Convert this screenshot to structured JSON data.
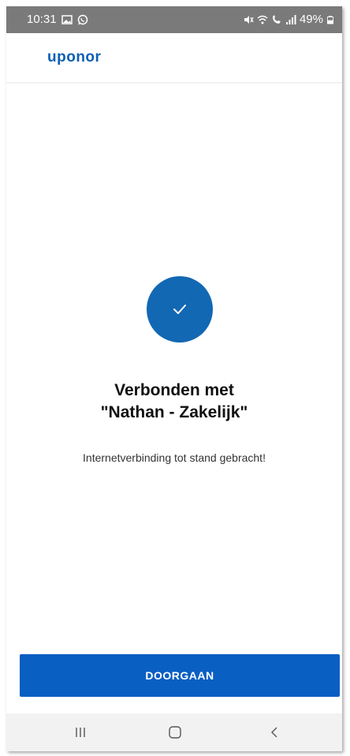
{
  "status_bar": {
    "time": "10:31",
    "battery": "49%",
    "left_icons": [
      "gallery-icon",
      "whatsapp-icon"
    ],
    "right_icons": [
      "mute-icon",
      "wifi-icon",
      "wifi-call-icon",
      "signal-icon",
      "battery-icon"
    ]
  },
  "header": {
    "logo": "uponor"
  },
  "content": {
    "icon": "checkmark-icon",
    "title_line1": "Verbonden met",
    "title_line2": "\"Nathan - Zakelijk\"",
    "subtitle": "Internetverbinding tot stand gebracht!"
  },
  "actions": {
    "continue_label": "DOORGAAN"
  },
  "colors": {
    "accent": "#0a5fc3",
    "status_bar": "#7a7a7a"
  },
  "nav": {
    "items": [
      "recents-icon",
      "home-icon",
      "back-icon"
    ]
  }
}
